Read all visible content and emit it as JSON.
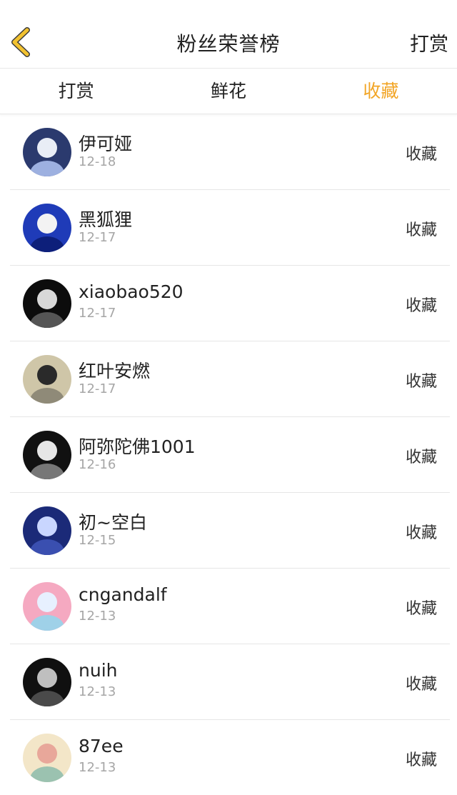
{
  "header": {
    "title": "粉丝荣誉榜",
    "right_label": "打赏"
  },
  "tabs": [
    {
      "label": "打赏",
      "active": false
    },
    {
      "label": "鲜花",
      "active": false
    },
    {
      "label": "收藏",
      "active": true
    }
  ],
  "colors": {
    "accent": "#f2a526"
  },
  "fans": [
    {
      "name": "伊可娅",
      "date": "12-18",
      "action": "收藏",
      "avatar_colors": [
        "#2b3a6e",
        "#e9edf6",
        "#9db0e0"
      ]
    },
    {
      "name": "黑狐狸",
      "date": "12-17",
      "action": "收藏",
      "avatar_colors": [
        "#1f3bb8",
        "#f3f3f3",
        "#0d1f7a"
      ]
    },
    {
      "name": "xiaobao520",
      "date": "12-17",
      "action": "收藏",
      "avatar_colors": [
        "#0c0c0c",
        "#d8d8d8",
        "#555555"
      ]
    },
    {
      "name": "红叶安燃",
      "date": "12-17",
      "action": "收藏",
      "avatar_colors": [
        "#cfc6a8",
        "#2a2a2a",
        "#8f8a78"
      ]
    },
    {
      "name": "阿弥陀佛1001",
      "date": "12-16",
      "action": "收藏",
      "avatar_colors": [
        "#111111",
        "#e6e6e6",
        "#777777"
      ]
    },
    {
      "name": "初~空白",
      "date": "12-15",
      "action": "收藏",
      "avatar_colors": [
        "#1b2a78",
        "#c9d6ff",
        "#3a4fb0"
      ]
    },
    {
      "name": "cngandalf",
      "date": "12-13",
      "action": "收藏",
      "avatar_colors": [
        "#f5a9c1",
        "#e7f0ff",
        "#9fd1e8"
      ]
    },
    {
      "name": "nuih",
      "date": "12-13",
      "action": "收藏",
      "avatar_colors": [
        "#101010",
        "#bfbfbf",
        "#4a4a4a"
      ]
    },
    {
      "name": "87ee",
      "date": "12-13",
      "action": "收藏",
      "avatar_colors": [
        "#f3e6c8",
        "#e8a79a",
        "#9bc2b0"
      ]
    }
  ]
}
